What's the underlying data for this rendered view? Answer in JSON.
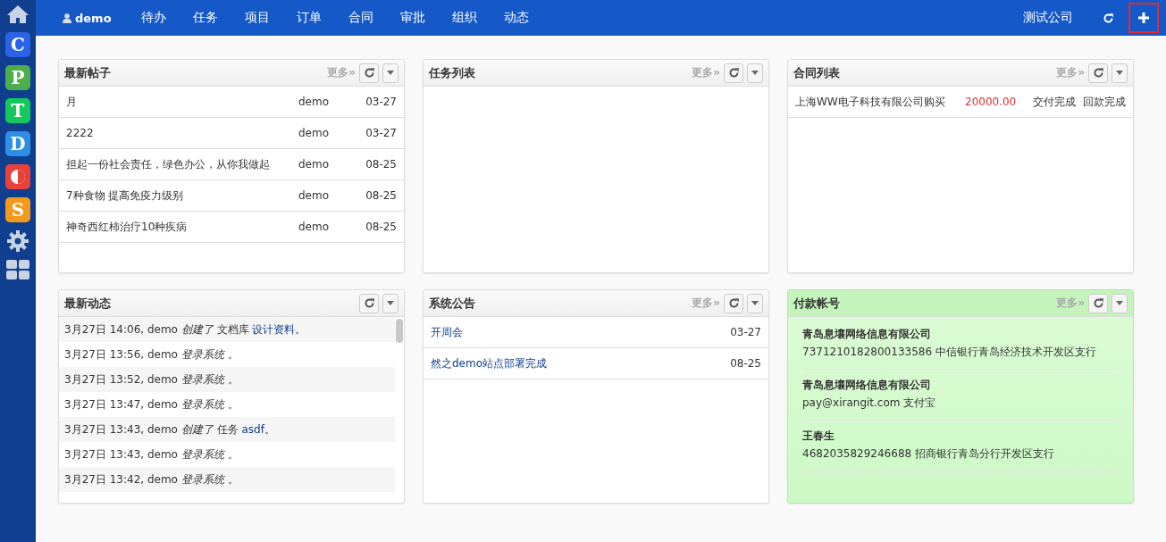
{
  "sidebar": {
    "apps": [
      {
        "kind": "home"
      },
      {
        "kind": "letter",
        "label": "C",
        "color": "#2b63e8"
      },
      {
        "kind": "letter",
        "label": "P",
        "color": "#4cae4c"
      },
      {
        "kind": "letter",
        "label": "T",
        "color": "#14c85a"
      },
      {
        "kind": "letter",
        "label": "D",
        "color": "#2f8fe6"
      },
      {
        "kind": "half",
        "color": "#e8403a"
      },
      {
        "kind": "letter",
        "label": "S",
        "color": "#f39a1b"
      },
      {
        "kind": "gear"
      },
      {
        "kind": "grid"
      }
    ]
  },
  "navbar": {
    "user": "demo",
    "items": [
      "待办",
      "任务",
      "项目",
      "订单",
      "合同",
      "审批",
      "组织",
      "动态"
    ],
    "company": "测试公司",
    "add_highlighted": true
  },
  "panels": [
    {
      "kind": "posts",
      "title": "最新帖子",
      "more": "更多»",
      "highlight": false,
      "rows": [
        {
          "title": "月",
          "author": "demo",
          "date": "03-27"
        },
        {
          "title": "2222",
          "author": "demo",
          "date": "03-27"
        },
        {
          "title": "担起一份社会责任，绿色办公，从你我做起",
          "author": "demo",
          "date": "08-25"
        },
        {
          "title": "7种食物 提高免疫力级别",
          "author": "demo",
          "date": "08-25"
        },
        {
          "title": "神奇西红柿治疗10种疾病",
          "author": "demo",
          "date": "08-25"
        }
      ]
    },
    {
      "kind": "empty",
      "title": "任务列表",
      "more": "更多»",
      "highlight": false
    },
    {
      "kind": "contracts",
      "title": "合同列表",
      "more": "更多»",
      "highlight": false,
      "rows": [
        {
          "name": "上海WW电子科技有限公司购买",
          "amount": "20000.00",
          "delivery": "交付完成",
          "payment": "回款完成"
        }
      ]
    },
    {
      "kind": "activity",
      "title": "最新动态",
      "highlight": false,
      "rows": [
        {
          "text": "3月27日 14:06, demo *创建了* 文档库 ",
          "link": "设计资料",
          "tail": "。"
        },
        {
          "text": "3月27日 13:56, demo *登录系统* 。"
        },
        {
          "text": "3月27日 13:52, demo *登录系统* 。"
        },
        {
          "text": "3月27日 13:47, demo *登录系统* 。"
        },
        {
          "text": "3月27日 13:43, demo *创建了* 任务 ",
          "link": "asdf",
          "tail": "。"
        },
        {
          "text": "3月27日 13:43, demo *登录系统* 。"
        },
        {
          "text": "3月27日 13:42, demo *登录系统* 。"
        }
      ]
    },
    {
      "kind": "notices",
      "title": "系统公告",
      "more": "更多»",
      "highlight": false,
      "rows": [
        {
          "title": "开周会",
          "date": "03-27"
        },
        {
          "title": "然之demo站点部署完成",
          "date": "08-25"
        }
      ]
    },
    {
      "kind": "accounts",
      "title": "付款帐号",
      "more": "更多»",
      "highlight": true,
      "rows": [
        {
          "name": "青岛息壤网络信息有限公司",
          "detail": "7371210182800133586 中信银行青岛经济技术开发区支行"
        },
        {
          "name": "青岛息壤网络信息有限公司",
          "detail": "pay@xirangit.com 支付宝"
        },
        {
          "name": "王春生",
          "detail": "4682035829246688 招商银行青岛分行开发区支行"
        }
      ]
    }
  ]
}
